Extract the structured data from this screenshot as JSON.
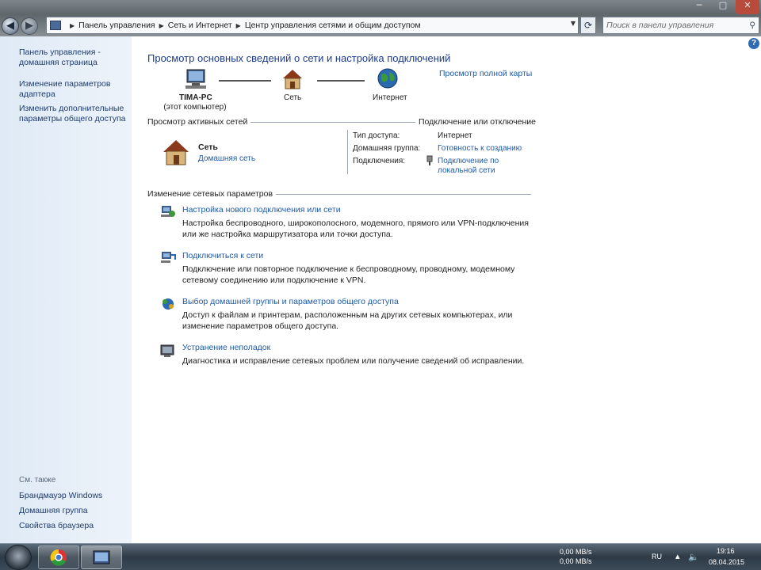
{
  "window": {
    "address": {
      "crumbs": [
        "Панель управления",
        "Сеть и Интернет",
        "Центр управления сетями и общим доступом"
      ]
    },
    "search": {
      "placeholder": "Поиск в панели управления"
    },
    "controls": {
      "minimize": "─",
      "maximize": "□",
      "close": "✕"
    }
  },
  "sidebar": {
    "links": [
      {
        "line1": "Панель управления -",
        "line2": "домашняя страница"
      },
      {
        "line1": "Изменение параметров",
        "line2": "адаптера"
      },
      {
        "line1": "Изменить дополнительные",
        "line2": "параметры общего доступа"
      }
    ],
    "see_also_title": "См. также",
    "see_also": [
      "Брандмауэр Windows",
      "Домашняя группа",
      "Свойства браузера"
    ]
  },
  "main": {
    "title": "Просмотр основных сведений о сети и настройка подключений",
    "full_map_link": "Просмотр полной карты",
    "map": {
      "computer_name": "TIMA-PC",
      "computer_sub": "(этот компьютер)",
      "network": "Сеть",
      "internet": "Интернет"
    },
    "active_networks": {
      "header": "Просмотр активных сетей",
      "connect_link": "Подключение или отключение",
      "network_name": "Сеть",
      "network_type": "Домашняя сеть",
      "access_type_label": "Тип доступа:",
      "access_type_value": "Интернет",
      "homegroup_label": "Домашняя группа:",
      "homegroup_value": "Готовность к созданию",
      "connections_label": "Подключения:",
      "connection_line1": "Подключение по",
      "connection_line2": "локальной сети"
    },
    "change_settings": {
      "header": "Изменение сетевых параметров",
      "items": [
        {
          "title": "Настройка нового подключения или сети",
          "desc1": "Настройка беспроводного, широкополосного, модемного, прямого или VPN-подключения",
          "desc2": "или же настройка маршрутизатора или точки доступа."
        },
        {
          "title": "Подключиться к сети",
          "desc1": "Подключение или повторное подключение к беспроводному, проводному, модемному",
          "desc2": "сетевому соединению или подключение к VPN."
        },
        {
          "title": "Выбор домашней группы и параметров общего доступа",
          "desc1": "Доступ к файлам и принтерам, расположенным на других сетевых компьютерах, или",
          "desc2": "изменение параметров общего доступа."
        },
        {
          "title": "Устранение неполадок",
          "desc1": "Диагностика и исправление сетевых проблем или получение сведений об исправлении.",
          "desc2": ""
        }
      ]
    }
  },
  "taskbar": {
    "net_up": "0,00 MB/s",
    "net_down": "0,00 MB/s",
    "lang": "RU",
    "time": "19:16",
    "date": "08.04.2015"
  },
  "colors": {
    "link": "#1e5aa8",
    "title": "#1e3c8c",
    "sidebar_bg": "#dfeaf6"
  }
}
